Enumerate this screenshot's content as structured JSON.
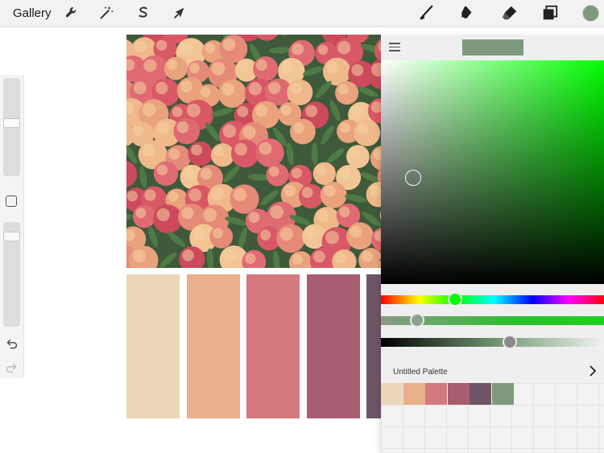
{
  "toolbar": {
    "gallery_label": "Gallery",
    "left_tools": [
      {
        "name": "actions",
        "icon": "wrench-icon"
      },
      {
        "name": "adjustments",
        "icon": "magic-wand-icon"
      },
      {
        "name": "selection",
        "icon": "selection-s-icon"
      },
      {
        "name": "transform",
        "icon": "arrow-cursor-icon"
      }
    ],
    "right_tools": [
      {
        "name": "brush",
        "icon": "brush-icon"
      },
      {
        "name": "smudge",
        "icon": "smudge-icon"
      },
      {
        "name": "eraser",
        "icon": "eraser-icon"
      },
      {
        "name": "layers",
        "icon": "layers-icon"
      }
    ],
    "current_color": "#7e9a7e"
  },
  "sidebar": {
    "brush_size_level": 0.55,
    "opacity_level": 0.1,
    "undo_icon": "undo-icon",
    "redo_icon": "redo-icon"
  },
  "canvas": {
    "photo_subject": "peaches",
    "swatches": [
      "#ecd6b8",
      "#e8b08b",
      "#d4797e",
      "#a85e70",
      "#6f5566"
    ]
  },
  "color_panel": {
    "current_color": "#7e9a7e",
    "hue_color": "#00ff00",
    "hue_level": 0.33,
    "saturation_level": 0.16,
    "brightness_level": 0.57,
    "palette": {
      "title": "Untitled Palette",
      "colors": [
        "#ecd6b8",
        "#e8b08b",
        "#d4797e",
        "#a85e70",
        "#6f5566",
        "#7e9a7e"
      ]
    }
  }
}
